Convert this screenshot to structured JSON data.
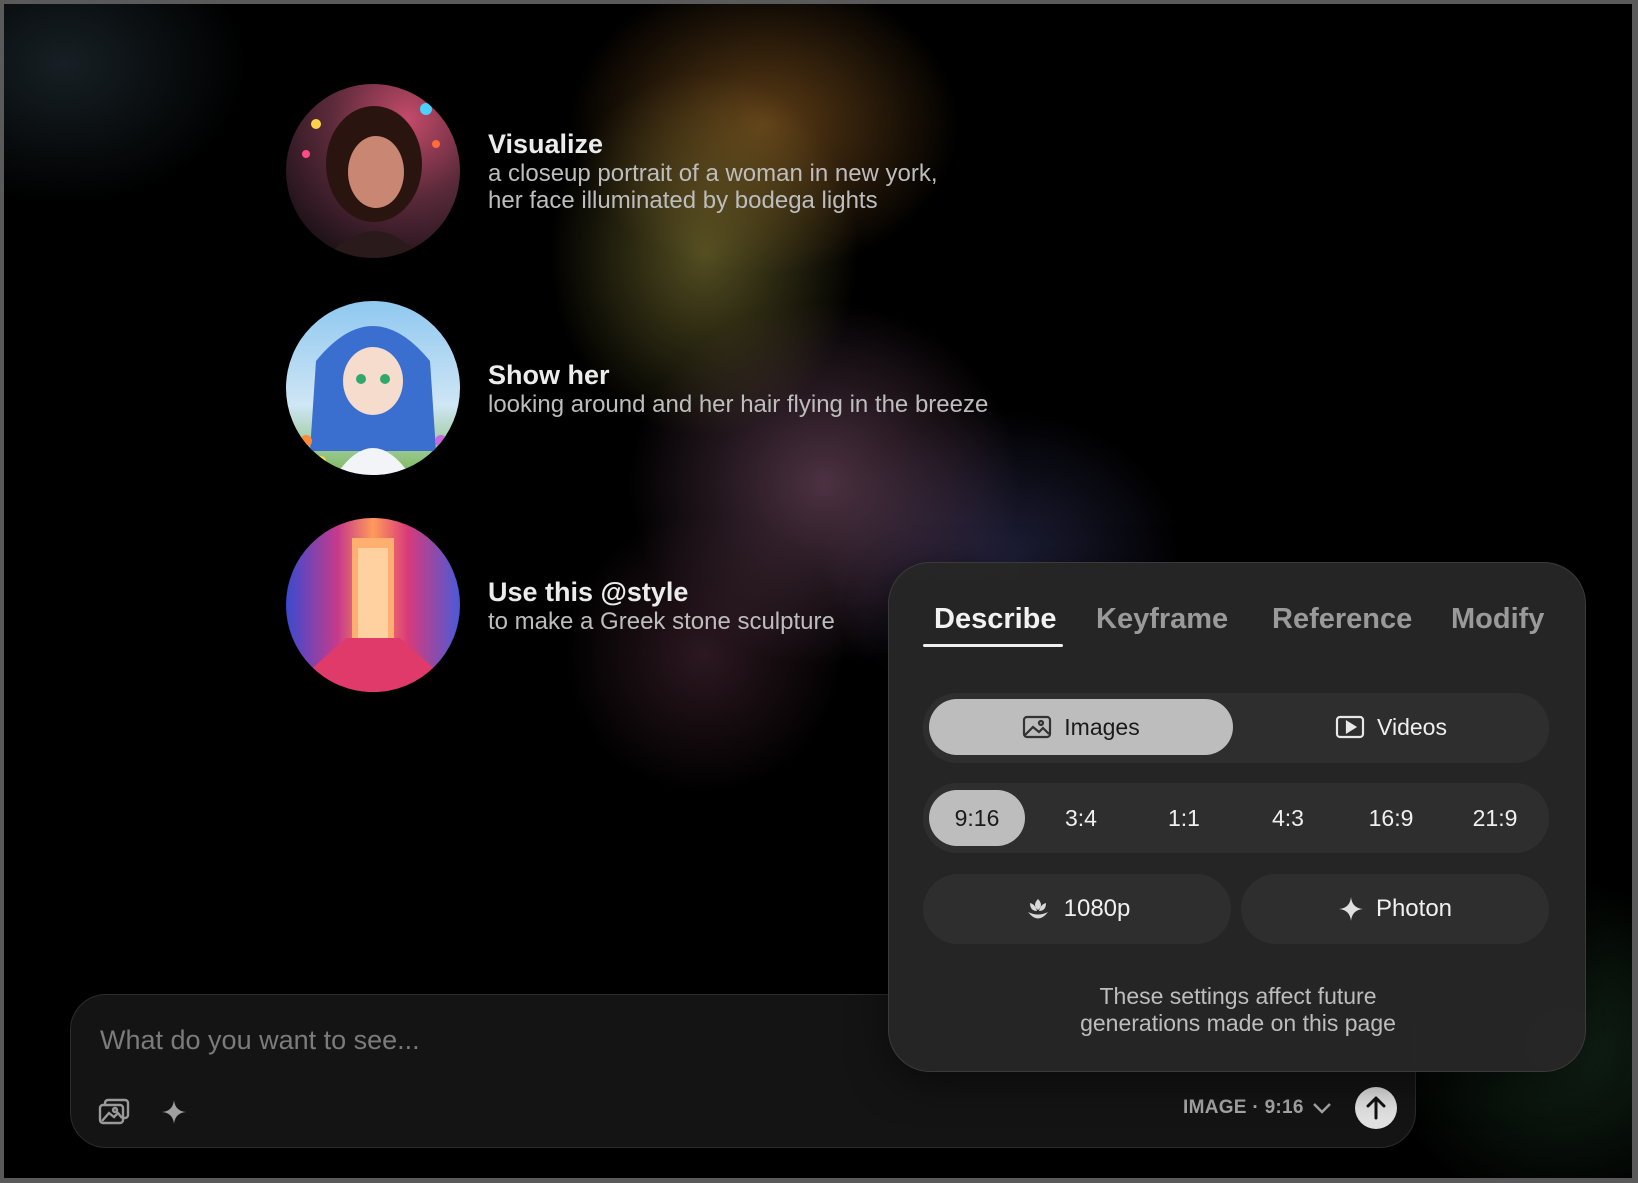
{
  "prompts": [
    {
      "title": "Visualize",
      "line1": "a closeup portrait of a woman in new york,",
      "line2": "her face illuminated by bodega lights"
    },
    {
      "title": "Show her",
      "line1": "looking around and her hair flying in the breeze"
    },
    {
      "title": "Use this @style",
      "line1": "to make a Greek stone sculpture"
    }
  ],
  "composer": {
    "placeholder": "What do you want to see...",
    "mode_label": "IMAGE · 9:16"
  },
  "panel": {
    "tabs": [
      "Describe",
      "Keyframe",
      "Reference",
      "Modify"
    ],
    "active_tab": "Describe",
    "media": {
      "images": "Images",
      "videos": "Videos",
      "selected": "Images"
    },
    "ratios": [
      "9:16",
      "3:4",
      "1:1",
      "4:3",
      "16:9",
      "21:9"
    ],
    "selected_ratio": "9:16",
    "resolution": "1080p",
    "model": "Photon",
    "note_line1": "These settings affect future",
    "note_line2": "generations made on this page"
  },
  "icons": [
    "image-upload-icon",
    "sparkle-icon",
    "chevron-down-icon",
    "arrow-up-icon",
    "image-icon",
    "video-icon",
    "flower-icon",
    "sparkle-icon"
  ],
  "colors": {
    "background": "#000000",
    "panel": "#262626",
    "selected_pill": "#bdbdbd",
    "send_button": "#e2e2e2"
  }
}
